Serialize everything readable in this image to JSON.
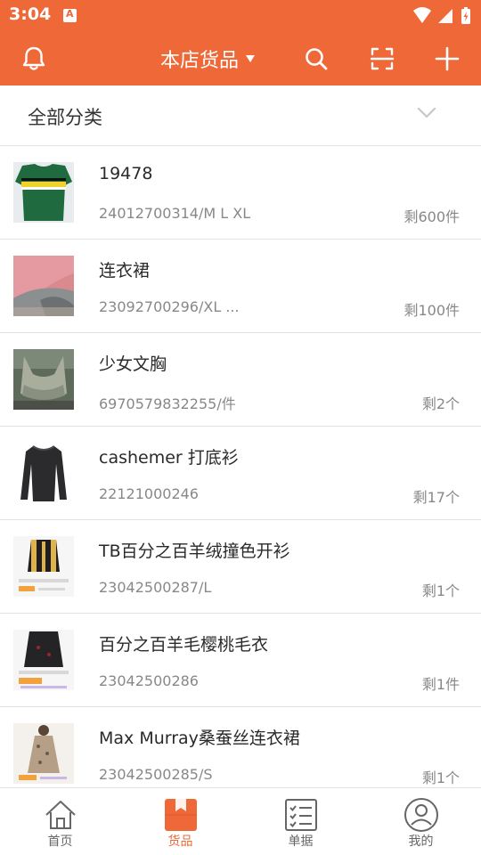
{
  "status_bar": {
    "time": "3:04"
  },
  "app_bar": {
    "title": "本店货品"
  },
  "category": {
    "label": "全部分类"
  },
  "products": [
    {
      "name": "19478",
      "code": "24012700314/M L XL",
      "stock": "剩600件"
    },
    {
      "name": "连衣裙",
      "code": "23092700296/XL  ...",
      "stock": "剩100件"
    },
    {
      "name": "少女文胸",
      "code": "6970579832255/件",
      "stock": "剩2个"
    },
    {
      "name": "cashemer 打底衫",
      "code": "22121000246",
      "stock": "剩17个"
    },
    {
      "name": "TB百分之百羊绒撞色开衫",
      "code": "23042500287/L",
      "stock": "剩1个"
    },
    {
      "name": "百分之百羊毛樱桃毛衣",
      "code": "23042500286",
      "stock": "剩1件"
    },
    {
      "name": "Max Murray桑蚕丝连衣裙",
      "code": "23042500285/S",
      "stock": "剩1个"
    }
  ],
  "bottom_nav": [
    {
      "label": "首页",
      "icon": "home-icon",
      "active": false
    },
    {
      "label": "货品",
      "icon": "goods-box-icon",
      "active": true
    },
    {
      "label": "单据",
      "icon": "list-doc-icon",
      "active": false
    },
    {
      "label": "我的",
      "icon": "profile-icon",
      "active": false
    }
  ],
  "colors": {
    "accent": "#ee6838",
    "text": "#2a2a2a",
    "subtext": "#888888",
    "divider": "#e2e2e2"
  }
}
